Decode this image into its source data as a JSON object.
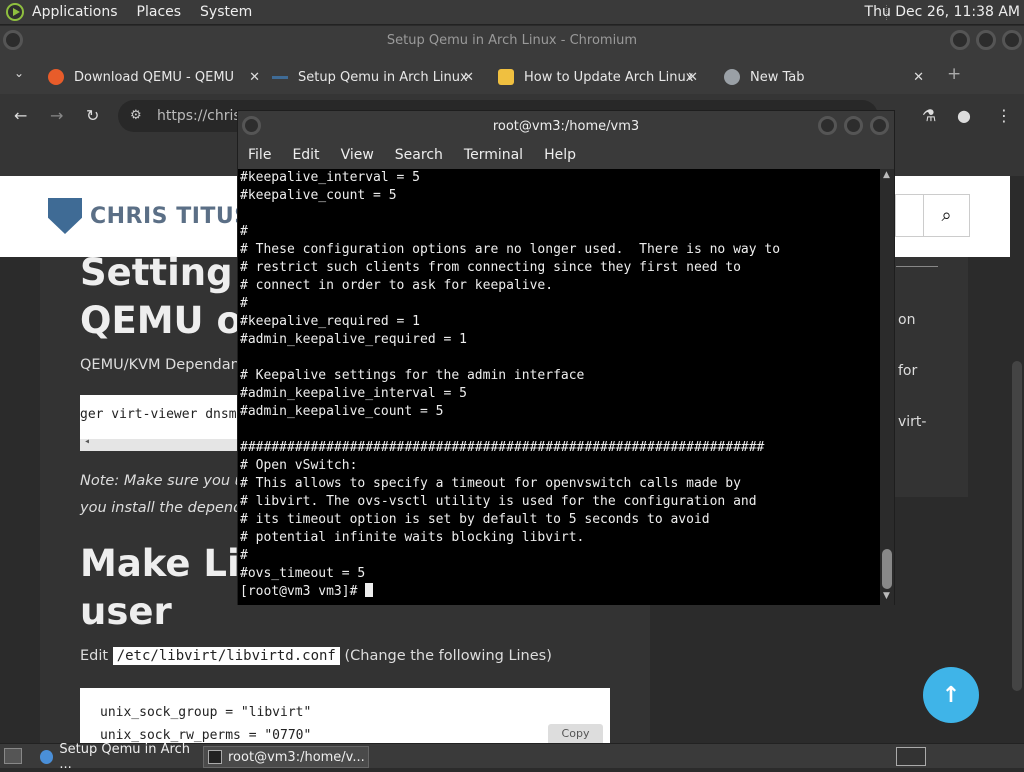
{
  "top_panel": {
    "menus": [
      "Applications",
      "Places",
      "System"
    ],
    "clock": "Thu Dec 26, 11:38 AM"
  },
  "chromium": {
    "window_title": "Setup Qemu in Arch Linux - Chromium",
    "tabs": [
      {
        "label": "Download QEMU - QEMU",
        "favicon_color": "#e85c2a"
      },
      {
        "label": "Setup Qemu in Arch Linux",
        "favicon_color": "#3f6b95"
      },
      {
        "label": "How to Update Arch Linux",
        "favicon_color": "#f0c040"
      },
      {
        "label": "New Tab",
        "favicon_color": "#9aa0a6"
      }
    ],
    "url": "https://christ"
  },
  "page": {
    "logo_text": "CHRIS TITUS",
    "heading1_lines": [
      "Setting u",
      "QEMU on"
    ],
    "dependencies_text": "QEMU/KVM Dependanc",
    "code_snippet": "ger virt-viewer dnsm",
    "note_line1": "Note: Make sure you u",
    "note_line2": "you install the depende",
    "heading2_lines": [
      "Make Libv",
      "user"
    ],
    "edit_prefix": "Edit",
    "edit_path": "/etc/libvirt/libvirtd.conf",
    "edit_suffix": "(Change the following Lines)",
    "code_lines": [
      "unix_sock_group = \"libvirt\"",
      "unix_sock_rw_perms = \"0770\""
    ],
    "copy_label": "Copy",
    "sidebar_fragments": [
      "on",
      "for",
      "virt-"
    ],
    "scroll_top_glyph": "↑"
  },
  "terminal": {
    "title": "root@vm3:/home/vm3",
    "menu": [
      "File",
      "Edit",
      "View",
      "Search",
      "Terminal",
      "Help"
    ],
    "lines": [
      "#keepalive_interval = 5",
      "#keepalive_count = 5",
      "",
      "#",
      "# These configuration options are no longer used.  There is no way to",
      "# restrict such clients from connecting since they first need to",
      "# connect in order to ask for keepalive.",
      "#",
      "#keepalive_required = 1",
      "#admin_keepalive_required = 1",
      "",
      "# Keepalive settings for the admin interface",
      "#admin_keepalive_interval = 5",
      "#admin_keepalive_count = 5",
      "",
      "###################################################################",
      "# Open vSwitch:",
      "# This allows to specify a timeout for openvswitch calls made by",
      "# libvirt. The ovs-vsctl utility is used for the configuration and",
      "# its timeout option is set by default to 5 seconds to avoid",
      "# potential infinite waits blocking libvirt.",
      "#",
      "#ovs_timeout = 5"
    ],
    "prompt": "[root@vm3 vm3]# "
  },
  "taskbar": {
    "tasks": [
      "Setup Qemu in Arch ...",
      "root@vm3:/home/v..."
    ]
  }
}
